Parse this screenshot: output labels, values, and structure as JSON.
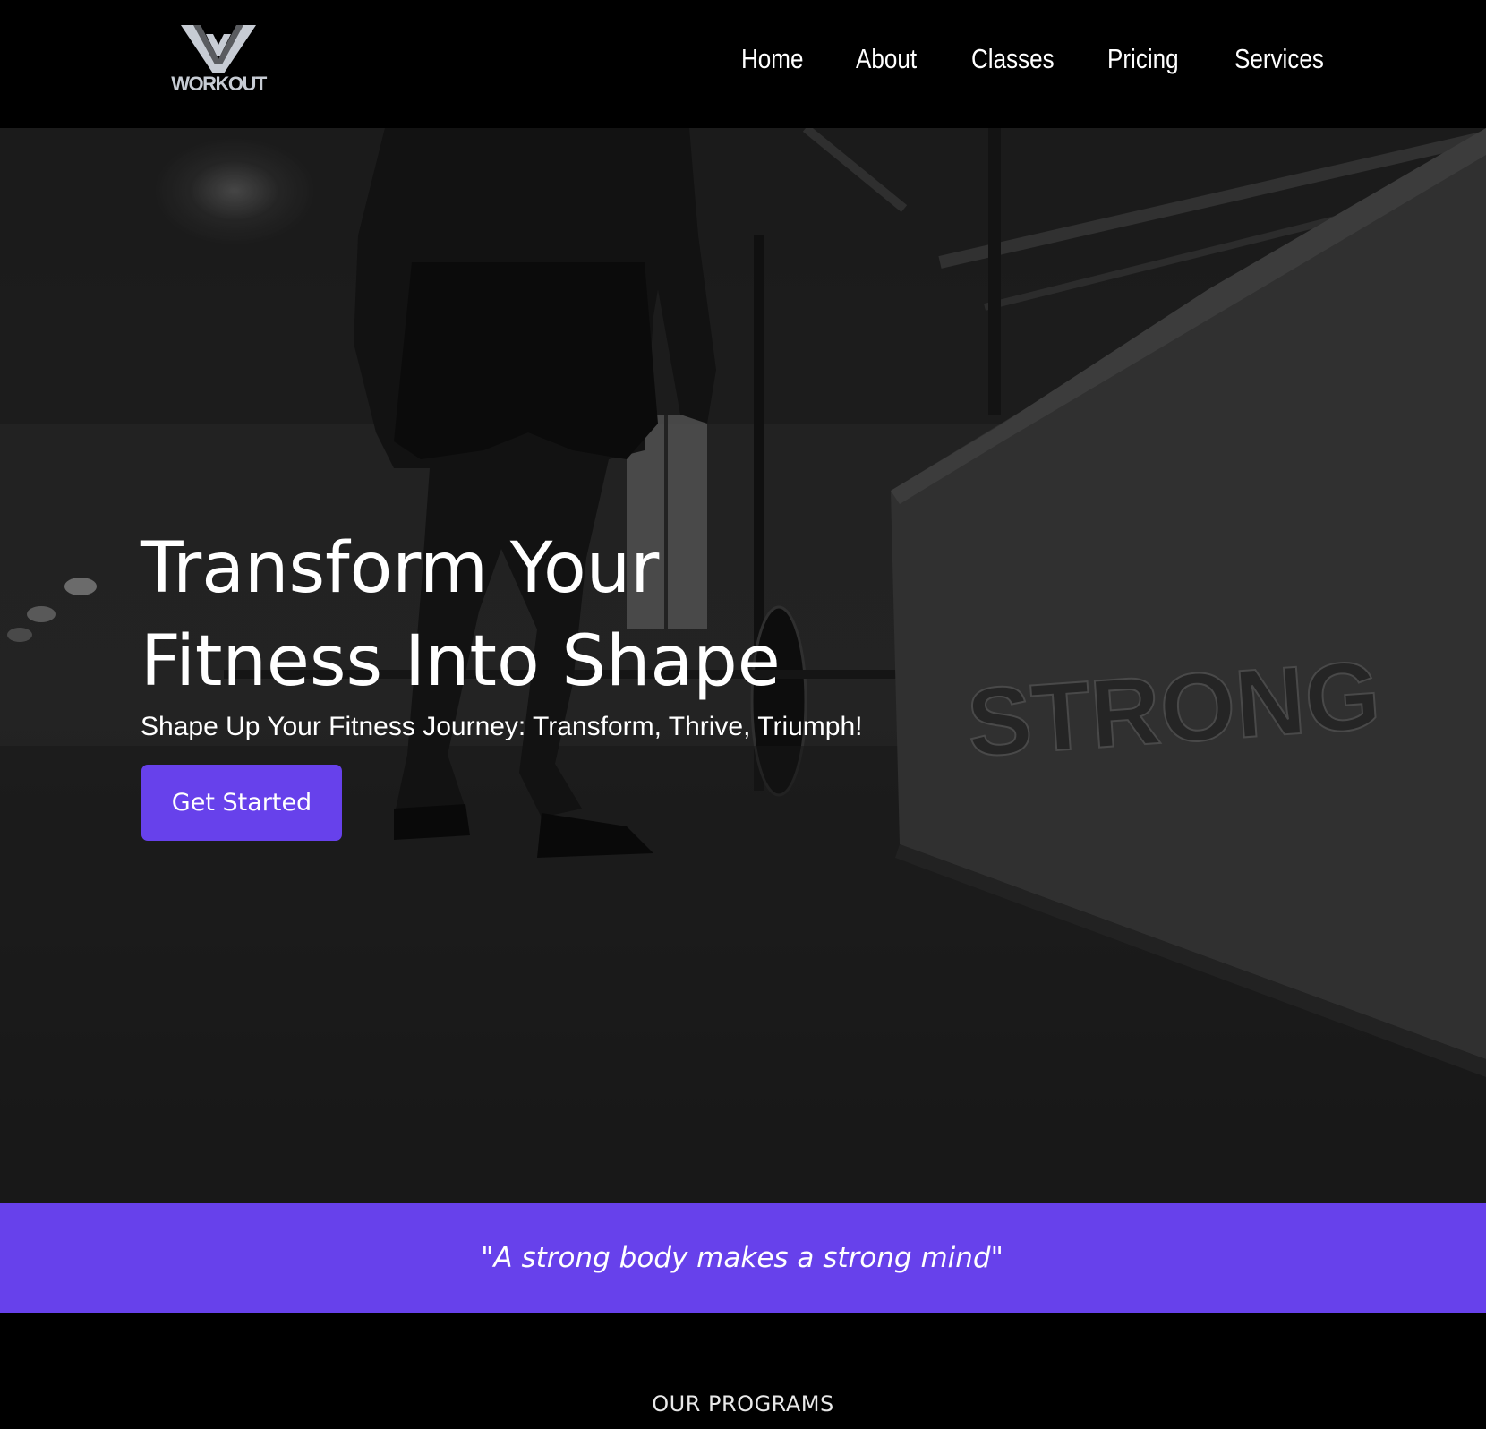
{
  "brand": {
    "logo_text": "WORKOUT",
    "logo_icon": "w-chevron-logo-icon"
  },
  "nav": {
    "items": [
      {
        "label": "Home"
      },
      {
        "label": "About"
      },
      {
        "label": "Classes"
      },
      {
        "label": "Pricing"
      },
      {
        "label": "Services"
      }
    ]
  },
  "hero": {
    "title_line1": "Transform Your",
    "title_line2": "Fitness Into Shape",
    "subtitle": "Shape Up Your Fitness Journey: Transform, Thrive, Triumph!",
    "cta_label": "Get Started",
    "box_engraving": "STRONG"
  },
  "quote": {
    "text": "\"A strong body makes a strong mind\""
  },
  "programs": {
    "heading": "OUR PROGRAMS"
  },
  "colors": {
    "accent": "#6741eb",
    "background": "#000000",
    "text": "#ffffff"
  }
}
